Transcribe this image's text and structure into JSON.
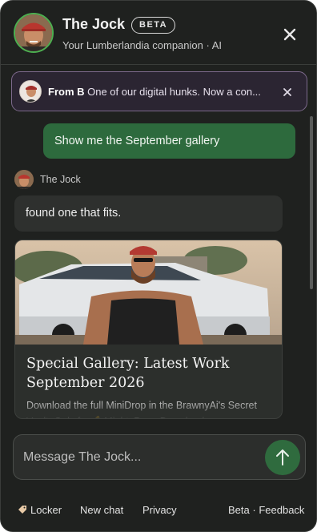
{
  "header": {
    "title": "The Jock",
    "badge": "BETA",
    "subtitle": "Your Lumberlandia companion · AI"
  },
  "notice": {
    "from_label": "From B",
    "message": "One of our digital hunks. Now a con..."
  },
  "messages": {
    "user_text": "Show me the September gallery",
    "bot_name": "The Jock",
    "bot_text": "found one that fits."
  },
  "card": {
    "title": "Special Gallery: Latest Work September 2026",
    "description": "Download the full MiniDrop in the BrawnyAi's Secret Vault. Only for 💪MightyPros. Download"
  },
  "composer": {
    "placeholder": "Message The Jock..."
  },
  "footer": {
    "locker": "Locker",
    "new_chat": "New chat",
    "privacy": "Privacy",
    "beta": "Beta",
    "separator": "·",
    "feedback": "Feedback"
  },
  "colors": {
    "accent_green": "#2d6a3d",
    "avatar_ring": "#4caf50",
    "notice_border": "#7d6a8c"
  }
}
